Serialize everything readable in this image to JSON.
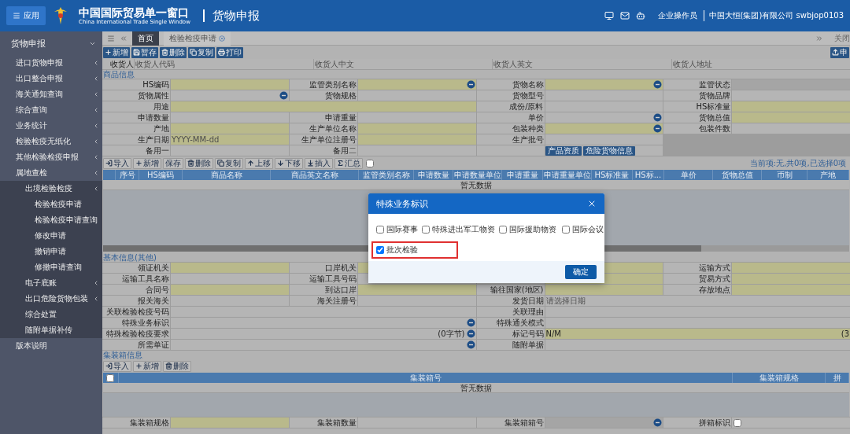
{
  "header": {
    "app_button": "应用",
    "title": "中国国际贸易单一窗口",
    "subtitle": "China International Trade Single Window",
    "module": "货物申报",
    "user_role": "企业操作员",
    "company": "中国大恒(集团)有限公司 swbjop0103"
  },
  "sidebar": {
    "items": [
      {
        "label": "货物申报",
        "expanded": true,
        "children": [
          {
            "label": "进口货物申报",
            "expandable": true
          },
          {
            "label": "出口整合申报",
            "expandable": true
          },
          {
            "label": "海关通知查询",
            "expandable": true
          },
          {
            "label": "综合查询",
            "expandable": true
          },
          {
            "label": "业务统计",
            "expandable": true
          },
          {
            "label": "检验检疫无纸化",
            "expandable": true
          },
          {
            "label": "其他检验检疫申报",
            "expandable": true
          },
          {
            "label": "属地查检",
            "expandable": true,
            "children": [
              {
                "label": "出境检验检疫",
                "expandable": true,
                "children": [
                  {
                    "label": "检验检疫申请",
                    "expandable": false
                  },
                  {
                    "label": "检验检疫申请查询",
                    "expandable": false
                  },
                  {
                    "label": "修改申请",
                    "expandable": false
                  },
                  {
                    "label": "撤销申请",
                    "expandable": false
                  },
                  {
                    "label": "修撤申请查询",
                    "expandable": false
                  }
                ]
              },
              {
                "label": "电子底账",
                "expandable": true
              },
              {
                "label": "出口危险货物包装",
                "expandable": true
              },
              {
                "label": "综合处置",
                "expandable": false
              },
              {
                "label": "随附单据补传",
                "expandable": false
              }
            ]
          },
          {
            "label": "版本说明",
            "expandable": false
          }
        ]
      }
    ]
  },
  "tabs": [
    {
      "label": "首页",
      "selected": true,
      "closable": false
    },
    {
      "label": "检验检疫申请",
      "selected": false,
      "closable": true
    }
  ],
  "close_tabs": "关闭",
  "toolbar": {
    "buttons": [
      {
        "label": "新增",
        "kind": "add"
      },
      {
        "label": "暂存",
        "kind": "save"
      },
      {
        "label": "删除",
        "kind": "delete"
      },
      {
        "label": "复制",
        "kind": "copy"
      },
      {
        "label": "打印",
        "kind": "print"
      }
    ],
    "right_button": {
      "label": "申",
      "kind": "upload"
    }
  },
  "consignee": {
    "label": "收货人",
    "fields": [
      {
        "placeholder": "收货人代码"
      },
      {
        "placeholder": "收货人中文"
      },
      {
        "placeholder": "收货人英文"
      },
      {
        "placeholder": "收货人地址"
      }
    ]
  },
  "goods": {
    "title": "商品信息",
    "form": [
      [
        {
          "label": "HS编码",
          "kind": "required"
        },
        {
          "label": "监管类别名称",
          "kind": "required",
          "lookup": true
        },
        {
          "label": "货物名称",
          "kind": "required",
          "lookup": true
        },
        {
          "label": "监管状态",
          "kind": "readonly"
        }
      ],
      [
        {
          "label": "货物属性",
          "kind": "plain",
          "lookup": true
        },
        {
          "label": "货物规格",
          "kind": "plain"
        },
        {
          "label": "货物型号",
          "kind": "plain"
        },
        {
          "label": "货物品牌",
          "kind": "plain"
        }
      ],
      [
        {
          "label": "用途",
          "kind": "required",
          "wide": true
        },
        {
          "label": "成份/原料",
          "kind": "plain"
        },
        {
          "label": "HS标准量",
          "kind": "required"
        }
      ],
      [
        {
          "label": "申请数量",
          "kind": "plain"
        },
        {
          "label": "申请重量",
          "kind": "plain"
        },
        {
          "label": "单价",
          "kind": "plain",
          "lookup": true
        },
        {
          "label": "货物总值",
          "kind": "required"
        }
      ],
      [
        {
          "label": "产地",
          "kind": "required"
        },
        {
          "label": "生产单位名称",
          "kind": "required"
        },
        {
          "label": "包装种类",
          "kind": "required",
          "lookup": true
        },
        {
          "label": "包装件数",
          "kind": "plain"
        }
      ],
      [
        {
          "label": "生产日期",
          "kind": "required",
          "placeholder": "YYYY-MM-dd"
        },
        {
          "label": "生产单位注册号",
          "kind": "required"
        },
        {
          "label": "生产批号",
          "kind": "plain"
        }
      ],
      [
        {
          "label": "备用一",
          "kind": "plain"
        },
        {
          "label": "备用二",
          "kind": "plain"
        },
        {
          "kind": "buttons",
          "buttons": [
            "产品资质",
            "危险货物信息"
          ]
        }
      ]
    ],
    "toolbar": [
      {
        "label": "导入",
        "kind": "import"
      },
      {
        "label": "新增",
        "kind": "add"
      },
      {
        "label": "保存",
        "kind": "plain"
      },
      {
        "label": "删除",
        "kind": "delete"
      },
      {
        "label": "复制",
        "kind": "copy"
      },
      {
        "label": "上移",
        "kind": "up"
      },
      {
        "label": "下移",
        "kind": "down"
      },
      {
        "label": "插入",
        "kind": "insert"
      },
      {
        "label": "汇总",
        "kind": "sum"
      }
    ],
    "summary_checked": false,
    "status": "当前项:无,共0项,已选择0项",
    "columns": [
      "序号",
      "HS编码",
      "商品名称",
      "商品英文名称",
      "监管类别名称",
      "申请数量",
      "申请数量单位",
      "申请重量",
      "申请重量单位",
      "HS标准量",
      "HS标...",
      "单价",
      "货物总值",
      "币制",
      "产地"
    ],
    "empty_text": "暂无数据"
  },
  "basic": {
    "title": "基本信息(其他)",
    "rows": [
      [
        {
          "label": "领证机关",
          "kind": "required"
        },
        {
          "label": "口岸机关",
          "kind": "required"
        },
        {
          "kind": "required"
        },
        {
          "label": "运输方式",
          "kind": "required"
        }
      ],
      [
        {
          "label": "运输工具名称",
          "kind": "plain"
        },
        {
          "label": "运输工具号码",
          "kind": "plain"
        },
        {
          "kind": "required"
        },
        {
          "label": "贸易方式",
          "kind": "required"
        }
      ],
      [
        {
          "label": "合同号",
          "kind": "required"
        },
        {
          "label": "到达口岸",
          "kind": "required"
        },
        {
          "label": "输往国家(地区)",
          "kind": "required"
        },
        {
          "label": "存放地点",
          "kind": "required"
        }
      ],
      [
        {
          "label": "报关海关",
          "kind": "plain"
        },
        {
          "label": "海关注册号",
          "kind": "plain"
        },
        {
          "label": "发货日期",
          "kind": "plain",
          "wide": true,
          "placeholder": "请选择日期"
        }
      ],
      [
        {
          "label": "关联检验检疫号码",
          "kind": "plain",
          "wide": true
        },
        {
          "label": "关联理由",
          "kind": "plain",
          "wide": true
        }
      ],
      [
        {
          "label": "特殊业务标识",
          "kind": "plain",
          "wide": true,
          "lookup": true
        },
        {
          "label": "特殊通关模式",
          "kind": "plain",
          "wide": true
        }
      ],
      [
        {
          "label": "特殊检验检疫要求",
          "kind": "plain",
          "wide": true,
          "lookup": true,
          "suffix": "(0字节)"
        },
        {
          "label": "标记号码",
          "kind": "required",
          "wide": true,
          "value": "N/M",
          "suffix": "(3"
        }
      ],
      [
        {
          "label": "所需单证",
          "kind": "plain",
          "wide": true,
          "lookup": true
        },
        {
          "label": "随附单据",
          "kind": "plain",
          "wide": true
        }
      ]
    ]
  },
  "container": {
    "title": "集装箱信息",
    "toolbar": [
      {
        "label": "导入",
        "kind": "import"
      },
      {
        "label": "新增",
        "kind": "add"
      },
      {
        "label": "删除",
        "kind": "delete"
      }
    ],
    "header_checked": false,
    "columns": [
      "集装箱号",
      "集装箱规格",
      "拼"
    ],
    "empty_text": "暂无数据",
    "form": [
      [
        {
          "label": "集装箱规格",
          "kind": "required"
        },
        {
          "label": "集装箱数量",
          "kind": "plain"
        },
        {
          "label": "集装箱箱号",
          "kind": "readonly",
          "lookup": true
        },
        {
          "label": "拼箱标识",
          "kind": "checkbox",
          "checked": false
        }
      ]
    ]
  },
  "dialog": {
    "title": "特殊业务标识",
    "options": [
      {
        "label": "国际赛事",
        "checked": false,
        "highlighted": false
      },
      {
        "label": "特殊进出军工物资",
        "checked": false,
        "highlighted": false
      },
      {
        "label": "国际援助物资",
        "checked": false,
        "highlighted": false
      },
      {
        "label": "国际会议",
        "checked": false,
        "highlighted": false
      },
      {
        "label": "批次检验",
        "checked": true,
        "highlighted": true
      }
    ],
    "confirm": "确定"
  }
}
